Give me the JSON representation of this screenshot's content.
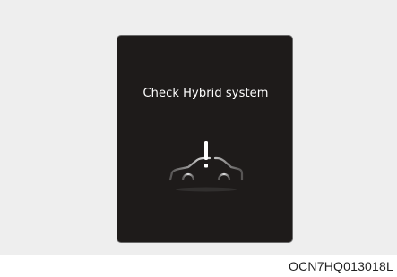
{
  "display": {
    "message": "Check Hybrid system",
    "icon": "car-warning-icon",
    "background_color": "#1e1b1a",
    "text_color": "#ffffff"
  },
  "figure": {
    "code": "OCN7HQ013018L"
  }
}
